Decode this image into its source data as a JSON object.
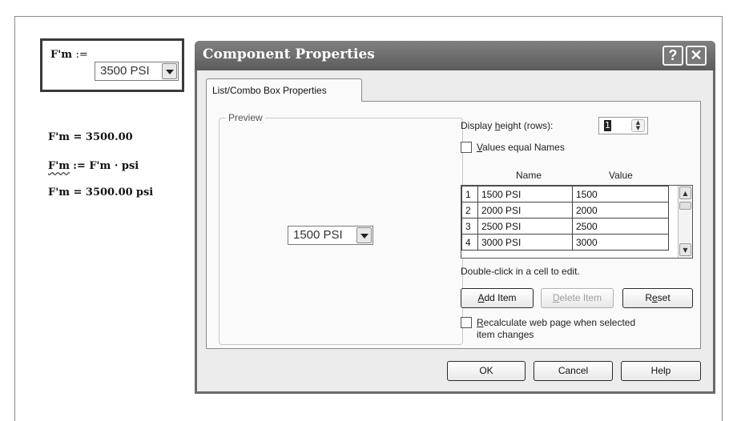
{
  "mathcad": {
    "combo_label": "F'm",
    "combo_assign": ":=",
    "combo_value": "3500 PSI",
    "line1": "F'm = 3500.00",
    "line2_lhs": "F'm",
    "line2_rhs": ":= F'm · psi",
    "line3": "F'm = 3500.00",
    "line3_unit": "psi"
  },
  "dialog": {
    "title": "Component Properties",
    "help_glyph": "?",
    "close_glyph": "✕",
    "tab_label": "List/Combo Box Properties",
    "preview_legend": "Preview",
    "preview_value": "1500 PSI",
    "display_height_pre": "Display ",
    "display_height_key": "h",
    "display_height_post": "eight (rows):",
    "display_height_value": "1",
    "values_equal_key": "V",
    "values_equal_post": "alues equal Names",
    "values_equal_checked": false,
    "grid": {
      "headers": [
        "Name",
        "Value"
      ],
      "rows": [
        {
          "index": "1",
          "name": "1500 PSI",
          "value": "1500"
        },
        {
          "index": "2",
          "name": "2000 PSI",
          "value": "2000"
        },
        {
          "index": "3",
          "name": "2500 PSI",
          "value": "2500"
        },
        {
          "index": "4",
          "name": "3000 PSI",
          "value": "3000"
        }
      ]
    },
    "edit_hint": "Double-click in a cell to edit.",
    "add_item_key": "A",
    "add_item_post": "dd Item",
    "delete_item_key": "D",
    "delete_item_post": "elete Item",
    "reset_pre": "R",
    "reset_key": "e",
    "reset_post": "set",
    "recalc_key": "R",
    "recalc_post": "ecalculate web page when selected",
    "recalc_line2": "item changes",
    "recalc_checked": false,
    "ok_label": "OK",
    "cancel_label": "Cancel",
    "help_label": "Help"
  },
  "icons": {
    "dropdown": "chevron-down-icon",
    "spin": "spinner-arrows-icon",
    "scroll_up": "scroll-up-icon",
    "scroll_down": "scroll-down-icon"
  }
}
